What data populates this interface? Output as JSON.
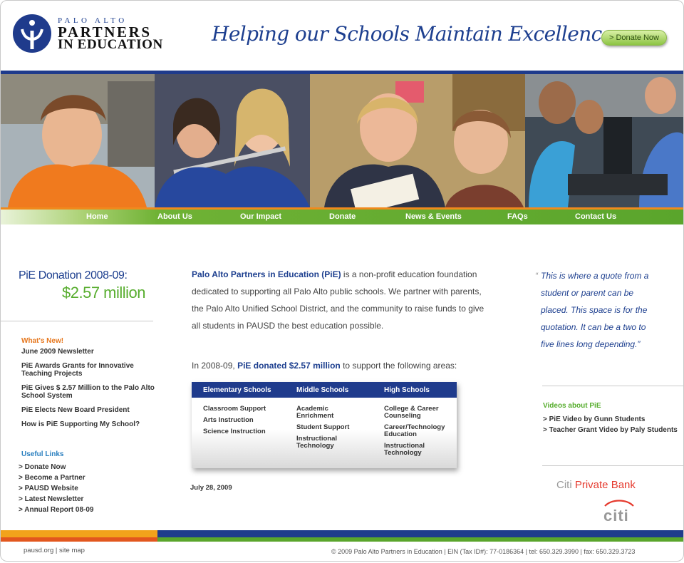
{
  "header": {
    "logo_line1": "PALO ALTO",
    "logo_line2": "PARTNERS",
    "logo_line3": "IN EDUCATION",
    "tagline": "Helping our Schools Maintain Excellence",
    "donate_button": "> Donate Now"
  },
  "colors": {
    "brand_blue": "#1f3b8c",
    "brand_green": "#5aa52c",
    "accent_orange": "#f08a1c"
  },
  "nav": [
    {
      "label": "Home"
    },
    {
      "label": "About Us"
    },
    {
      "label": "Our Impact"
    },
    {
      "label": "Donate"
    },
    {
      "label": "News & Events"
    },
    {
      "label": "FAQs"
    },
    {
      "label": "Contact Us"
    }
  ],
  "left": {
    "donation_title": "PiE Donation 2008-09:",
    "donation_amount": "$2.57 million",
    "whatsnew_heading": "What's New!",
    "whatsnew": [
      "June 2009 Newsletter",
      "PiE Awards Grants for Innovative Teaching Projects",
      "PiE Gives $ 2.57 Million to the Palo Alto School System",
      "PiE Elects New Board President",
      "How is PiE Supporting My School?"
    ],
    "links_heading": "Useful Links",
    "links": [
      "> Donate Now",
      "> Become a Partner",
      "> PAUSD Website",
      "> Latest Newsletter",
      "> Annual Report 08-09"
    ]
  },
  "main": {
    "intro_name": "Palo Alto Partners in Education (PiE)",
    "intro_text": " is a non-profit education foundation dedicated to supporting all Palo Alto public schools. We partner with parents, the Palo Alto Unified School District, and the community to raise funds to give all students in PAUSD the best education possible.",
    "lead_pre": "In 2008-09, ",
    "lead_strong": "PiE donated $2.57 million",
    "lead_post": " to support the following areas:",
    "areas": [
      {
        "title": "Elementary Schools",
        "items": [
          "Classroom Support",
          "Arts Instruction",
          "Science Instruction"
        ]
      },
      {
        "title": "Middle Schools",
        "items": [
          "Academic Enrichment",
          "Student Support",
          "Instructional Technology"
        ]
      },
      {
        "title": "High Schools",
        "items": [
          "College & Career Counseling",
          "Career/Technology Education",
          "Instructional Technology"
        ]
      }
    ],
    "date": "July 28, 2009"
  },
  "right": {
    "quote_open": "“",
    "quote": "This is where a quote from a student or parent can be placed. This space is for the quotation. It can be a two to five lines long depending.”",
    "videos_heading": "Videos about PiE",
    "videos": [
      "> PiE Video by Gunn Students",
      "> Teacher Grant Video by Paly Students"
    ],
    "sponsor_prefix": "Citi",
    "sponsor_name": "Private Bank",
    "sponsor_logo_text": "citi"
  },
  "footer": {
    "left_link1": "pausd.org",
    "left_sep": " | ",
    "left_link2": "site map",
    "right": "© 2009 Palo Alto Partners in Education | EIN (Tax ID#): 77-0186364 | tel: 650.329.3990 | fax: 650.329.3723"
  }
}
